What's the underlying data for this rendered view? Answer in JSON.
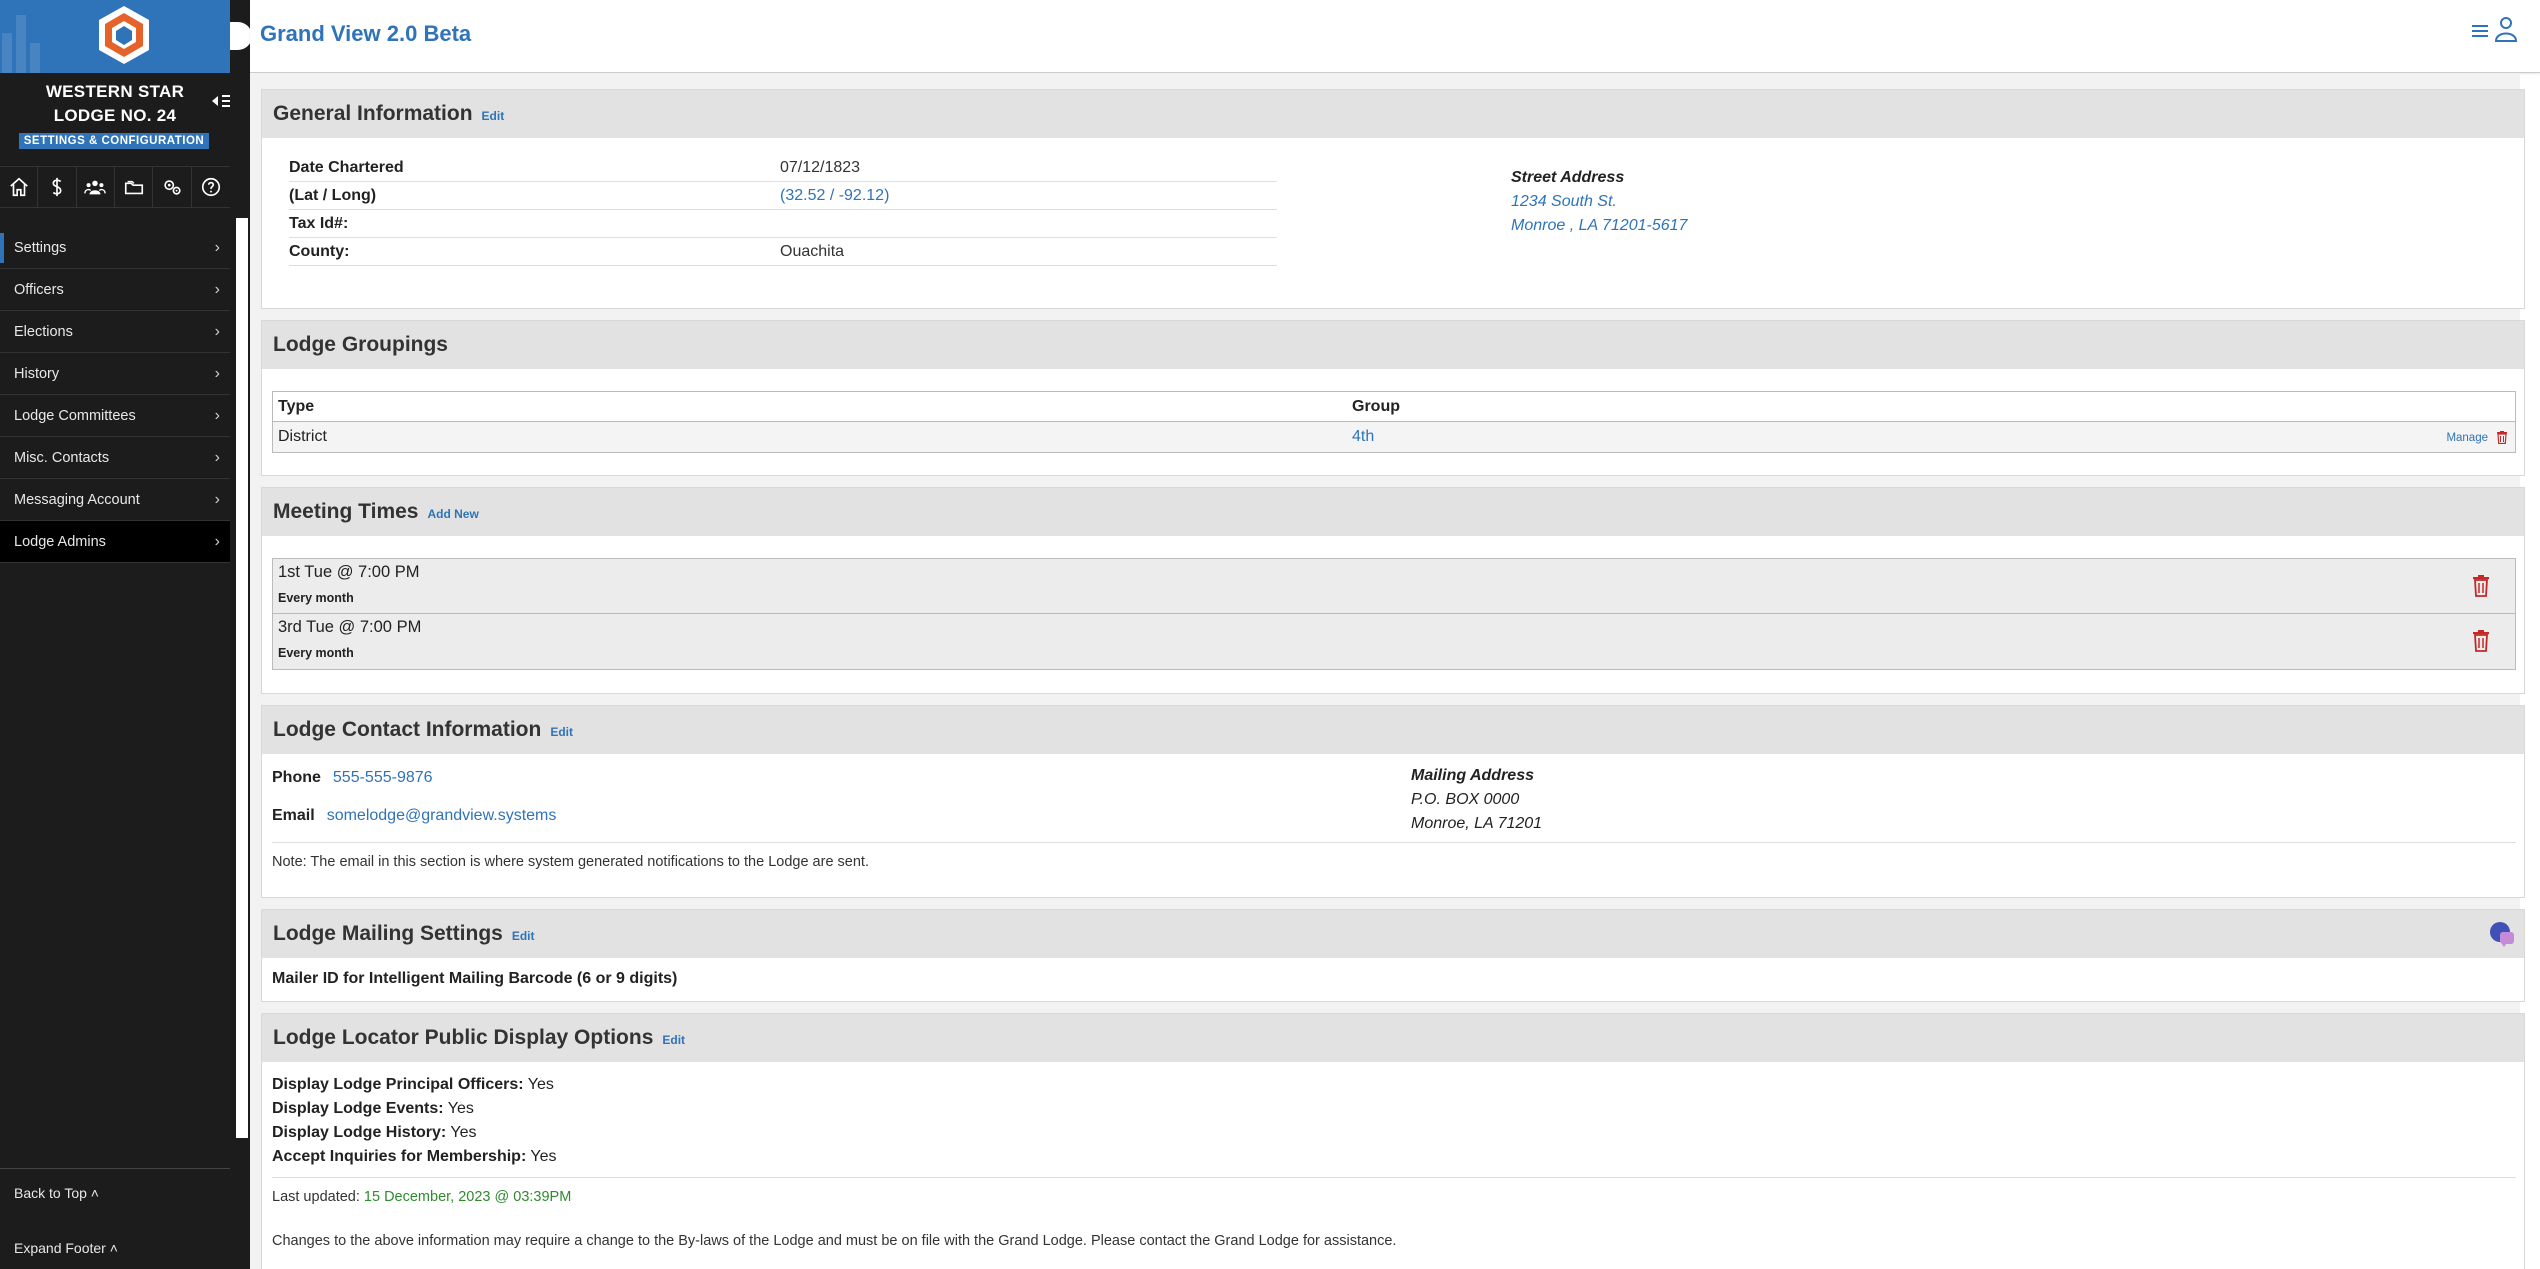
{
  "app": {
    "title": "Grand View 2.0 Beta"
  },
  "sidebar": {
    "lodge_name_line1": "WESTERN STAR",
    "lodge_name_line2": "LODGE NO. 24",
    "badge": "SETTINGS & CONFIGURATION",
    "icons": [
      "home-icon",
      "dollar-icon",
      "members-icon",
      "folders-icon",
      "gears-icon",
      "help-icon"
    ],
    "items": [
      {
        "label": "Settings"
      },
      {
        "label": "Officers"
      },
      {
        "label": "Elections"
      },
      {
        "label": "History"
      },
      {
        "label": "Lodge Committees"
      },
      {
        "label": "Misc. Contacts"
      },
      {
        "label": "Messaging Account"
      },
      {
        "label": "Lodge Admins"
      }
    ],
    "back_to_top": "Back to Top",
    "expand_footer": "Expand Footer"
  },
  "general": {
    "title": "General Information",
    "edit": "Edit",
    "rows": [
      {
        "label": "Date Chartered",
        "value": "07/12/1823"
      },
      {
        "label": "(Lat / Long)",
        "value": "(32.52 / -92.12)"
      },
      {
        "label": "Tax Id#:",
        "value": ""
      },
      {
        "label": "County:",
        "value": "Ouachita"
      }
    ],
    "street_address_title": "Street Address",
    "street_line1": "1234 South St.",
    "street_line2": "Monroe , LA   71201-5617"
  },
  "groupings": {
    "title": "Lodge Groupings",
    "col_type": "Type",
    "col_group": "Group",
    "rows": [
      {
        "type": "District",
        "group": "4th",
        "action": "Manage"
      }
    ]
  },
  "meetings": {
    "title": "Meeting Times",
    "add_new": "Add New",
    "rows": [
      {
        "time": "1st Tue @ 7:00 PM",
        "freq": "Every month"
      },
      {
        "time": "3rd Tue @ 7:00 PM",
        "freq": "Every month"
      }
    ]
  },
  "contact": {
    "title": "Lodge Contact Information",
    "edit": "Edit",
    "phone_label": "Phone",
    "phone": "555-555-9876",
    "email_label": "Email",
    "email": "somelodge@grandview.systems",
    "mailing_title": "Mailing Address",
    "mailing_line1": "P.O. BOX 0000",
    "mailing_line2": "Monroe, LA 71201",
    "note": "Note: The email in this section is where system generated notifications to the Lodge are sent."
  },
  "mailing": {
    "title": "Lodge Mailing Settings",
    "edit": "Edit",
    "mailer_label": "Mailer ID for Intelligent Mailing Barcode (6 or 9 digits)"
  },
  "locator": {
    "title": "Lodge Locator Public Display Options",
    "edit": "Edit",
    "officers_label": "Display Lodge Principal Officers:",
    "officers_value": "Yes",
    "events_label": "Display Lodge Events:",
    "events_value": "Yes",
    "history_label": "Display Lodge History:",
    "history_value": "Yes",
    "inquiries_label": "Accept Inquiries for Membership:",
    "inquiries_value": "Yes",
    "last_updated_label": "Last updated:",
    "last_updated_value": "15 December, 2023 @ 03:39PM",
    "footnote": "Changes to the above information may require a change to the By-laws of the Lodge and must be on file with the Grand Lodge. Please contact the Grand Lodge for assistance."
  },
  "colors": {
    "accent": "#2f73b9",
    "sidebar": "#1c1c1c",
    "section_head": "#e2e2e2",
    "danger": "#c62828",
    "success": "#2e8b2e"
  }
}
